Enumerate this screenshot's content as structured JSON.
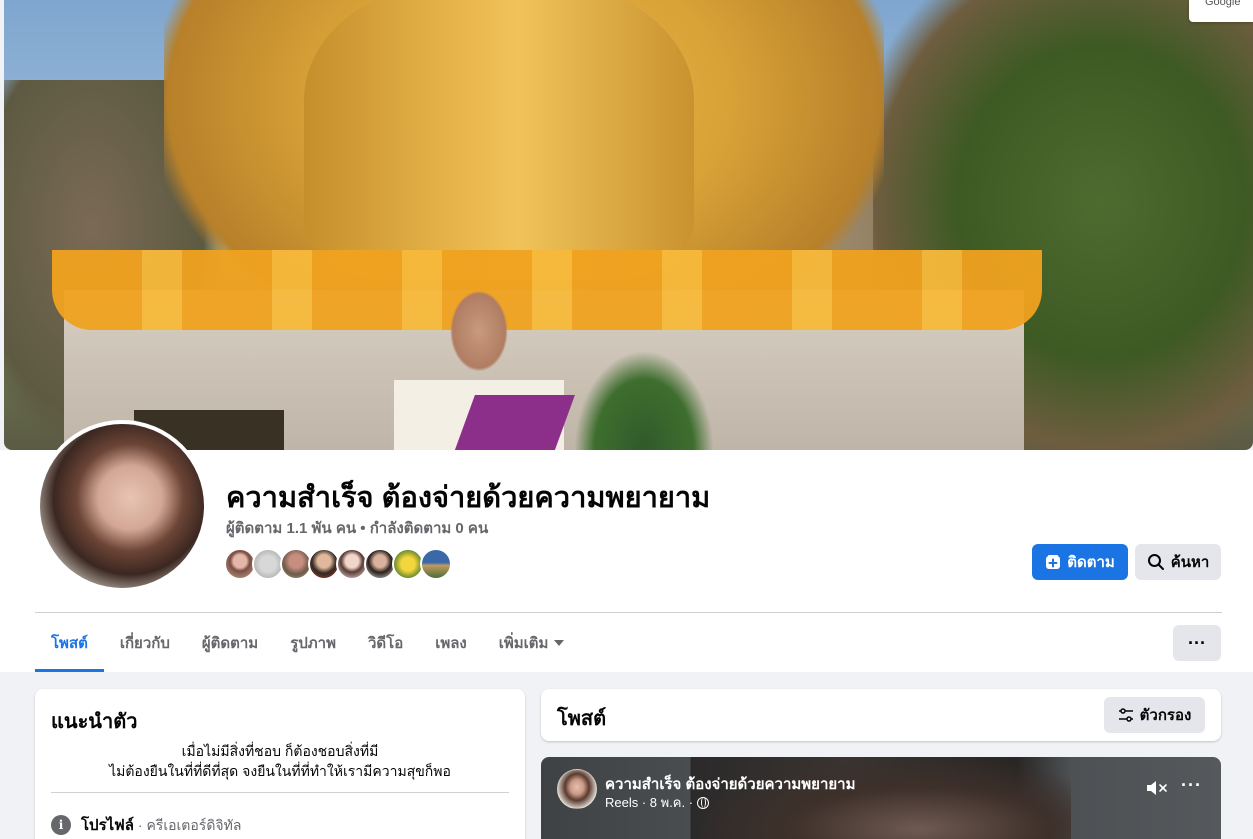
{
  "cover": {
    "partial_button_text": "Google"
  },
  "page": {
    "name": "ความสำเร็จ ต้องจ่ายด้วยความพยายาม",
    "followers": "ผู้ติดตาม 1.1 พัน คน • กำลังติดตาม 0 คน"
  },
  "actions": {
    "follow": "ติดตาม",
    "search": "ค้นหา",
    "more": "···"
  },
  "tabs": [
    {
      "label": "โพสต์",
      "active": true
    },
    {
      "label": "เกี่ยวกับ"
    },
    {
      "label": "ผู้ติดตาม"
    },
    {
      "label": "รูปภาพ"
    },
    {
      "label": "วิดีโอ"
    },
    {
      "label": "เพลง"
    },
    {
      "label": "เพิ่มเติม"
    }
  ],
  "intro": {
    "title": "แนะนำตัว",
    "bio_line1": "เมื่อไม่มีสิ่งที่ชอบ ก็ต้องชอบสิ่งที่มี",
    "bio_line2": "ไม่ต้องยืนในที่ที่ดีที่สุด จงยืนในที่ที่ทำให้เรามีความสุขก็พอ",
    "profile_label": "โปรไฟล์",
    "profile_value": " · ครีเอเตอร์ดิจิทัล"
  },
  "posts": {
    "title": "โพสต์",
    "filter": "ตัวกรอง"
  },
  "reel": {
    "author": "ความสำเร็จ ต้องจ่ายด้วยความพยายาม",
    "meta": "Reels · 8 พ.ค. ·",
    "more": "···"
  },
  "colors": {
    "accent": "#1b74e4",
    "secondary_button": "#e4e6eb",
    "page_bg": "#f0f2f5",
    "muted_text": "#65676b"
  }
}
